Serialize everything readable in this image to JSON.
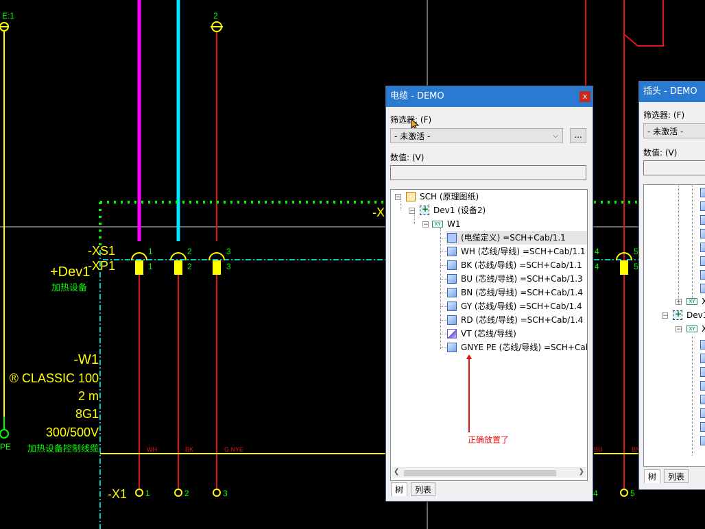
{
  "schematic": {
    "top_labels": {
      "left": "E:1",
      "wire2": "2"
    },
    "device": {
      "terminal_xs": "-XS1",
      "terminal_xp": "-XP1",
      "name": "+Dev1",
      "desc": "加热设备"
    },
    "pins_top": [
      "1",
      "2",
      "3"
    ],
    "pins_bottom": [
      "1",
      "2",
      "3"
    ],
    "right_pins_top": [
      "4",
      "5"
    ],
    "right_pins_bottom": [
      "4",
      "5"
    ],
    "dim_label": "-X",
    "cable": {
      "name": "-W1",
      "type": "® CLASSIC 100",
      "length": "2 m",
      "cores": "8G1",
      "voltage": "300/500V",
      "desc": "加热设备控制线缆"
    },
    "pe_label": "PE",
    "wire_labels": [
      "WH",
      "BK",
      "G NYE"
    ],
    "right_wire_labels": [
      "BU",
      "BN"
    ],
    "terminal_x1": "-X1",
    "x1_pins": [
      "1",
      "2",
      "3"
    ],
    "right_x_pins": [
      "4",
      "5"
    ],
    "annotation": "正确放置了",
    "colors": {
      "magenta": "#ff00ff",
      "cyan": "#00e5ff",
      "red": "#e01515",
      "yellow": "#ffff00",
      "green": "#00ff00",
      "teal": "#00d0c0"
    }
  },
  "cable_window": {
    "title": "电缆 - DEMO",
    "close": "x",
    "filter_label": "筛选器: (F)",
    "filter_value": "- 未激活 -",
    "more_button": "...",
    "value_label": "数值: (V)",
    "tree": [
      {
        "id": "sch",
        "label": "SCH (原理图纸)",
        "icon": "schematic-icon",
        "expander": "−"
      },
      {
        "id": "dev1",
        "label": "Dev1 (设备2)",
        "icon": "device-icon",
        "expander": "−"
      },
      {
        "id": "w1",
        "label": "W1",
        "icon": "xy-icon",
        "expander": "−"
      },
      {
        "id": "def",
        "label": "(电缆定义) =SCH+Cab/1.1",
        "icon": "cable-definition-icon",
        "selected": true
      },
      {
        "id": "wh",
        "label": "WH (芯线/导线) =SCH+Cab/1.1",
        "icon": "core-icon"
      },
      {
        "id": "bk",
        "label": "BK (芯线/导线) =SCH+Cab/1.1",
        "icon": "core-icon"
      },
      {
        "id": "bu",
        "label": "BU (芯线/导线) =SCH+Cab/1.3",
        "icon": "core-icon"
      },
      {
        "id": "bn",
        "label": "BN (芯线/导线) =SCH+Cab/1.4",
        "icon": "core-icon"
      },
      {
        "id": "gy",
        "label": "GY (芯线/导线) =SCH+Cab/1.4",
        "icon": "core-icon"
      },
      {
        "id": "rd",
        "label": "RD (芯线/导线) =SCH+Cab/1.4",
        "icon": "core-icon"
      },
      {
        "id": "vt",
        "label": "VT (芯线/导线)",
        "icon": "unplaced-core-icon"
      },
      {
        "id": "gnye",
        "label": "GNYE PE (芯线/导线) =SCH+Cab",
        "icon": "core-icon"
      }
    ],
    "tabs": [
      "树",
      "列表"
    ]
  },
  "plug_window": {
    "title": "插头 - DEMO",
    "filter_label": "筛选器: (F)",
    "filter_value": "- 未激活 -",
    "value_label": "数值: (V)",
    "tree": [
      {
        "label": "X",
        "icon": "xy-icon",
        "expander": "+"
      },
      {
        "label": "Dev1",
        "icon": "device-icon",
        "expander": "−"
      },
      {
        "label": "X",
        "icon": "xy-icon",
        "expander": "−"
      }
    ],
    "tabs": [
      "树",
      "列表"
    ]
  }
}
